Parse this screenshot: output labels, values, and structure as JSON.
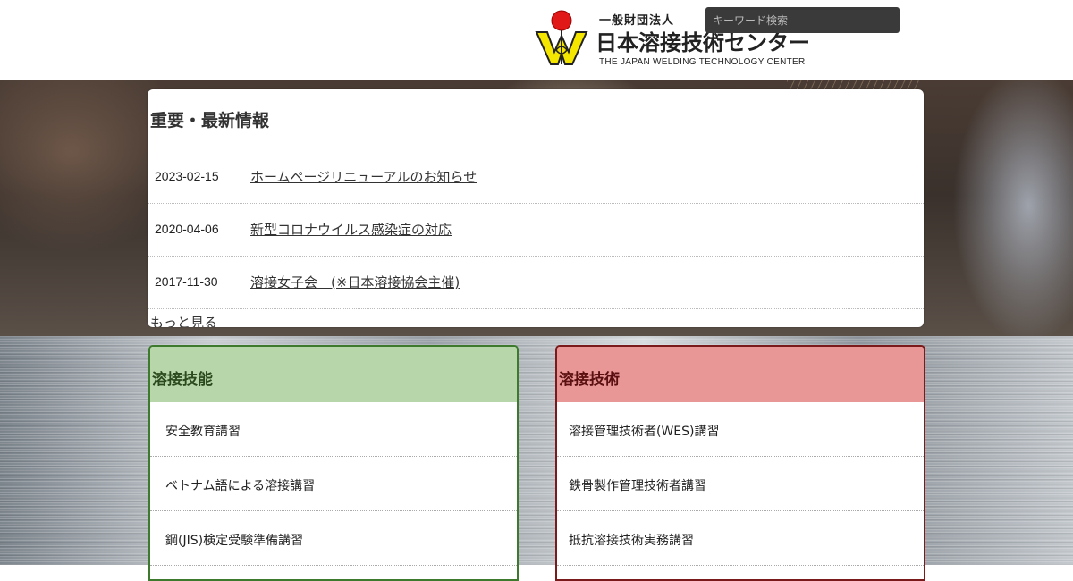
{
  "header": {
    "logo": {
      "sub": "一般財団法人",
      "title": "日本溶接技術センター",
      "en": "THE JAPAN WELDING TECHNOLOGY CENTER"
    },
    "search": {
      "placeholder": "キーワード検索",
      "value": ""
    }
  },
  "news": {
    "title": "重要・最新情報",
    "items": [
      {
        "date": "2023-02-15",
        "title": "ホームページリニューアルのお知らせ"
      },
      {
        "date": "2020-04-06",
        "title": "新型コロナウイルス感染症の対応"
      },
      {
        "date": "2017-11-30",
        "title": "溶接女子会　(※日本溶接協会主催)"
      }
    ],
    "more": "もっと見る"
  },
  "panels": {
    "skill": {
      "title": "溶接技能",
      "color": "#b7d7aa",
      "border": "#3d7a2d",
      "items": [
        "安全教育講習",
        "ベトナム語による溶接講習",
        "鋼(JIS)検定受験準備講習"
      ]
    },
    "tech": {
      "title": "溶接技術",
      "color": "#e89696",
      "border": "#7a1a1a",
      "items": [
        "溶接管理技術者(WES)講習",
        "鉄骨製作管理技術者講習",
        "抵抗溶接技術実務講習"
      ]
    }
  }
}
